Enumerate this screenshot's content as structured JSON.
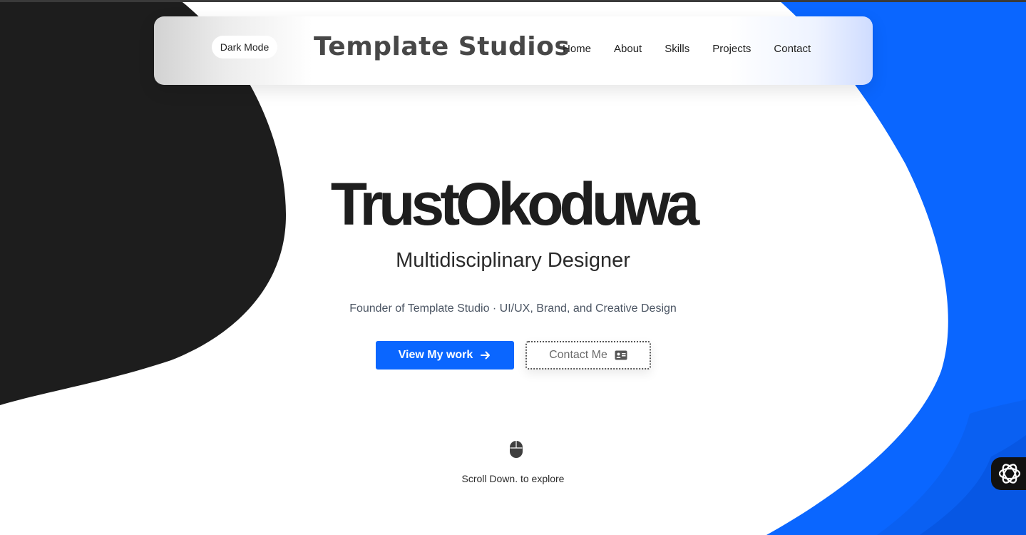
{
  "colors": {
    "accent": "#0a66ff",
    "dark_shape": "#1d1d1d",
    "blue_shape": "#0a66ff",
    "text": "#1e1e1e"
  },
  "header": {
    "dark_mode_label": "Dark Mode",
    "brand": "Template Studios",
    "nav": [
      "Home",
      "About",
      "Skills",
      "Projects",
      "Contact"
    ]
  },
  "hero": {
    "name": "TrustOkoduwa",
    "title": "Multidisciplinary Designer",
    "subtitle": "Founder of Template Studio · UI/UX, Brand, and Creative Design",
    "primary_button": {
      "label": "View My work",
      "icon": "arrow-right-icon"
    },
    "secondary_button": {
      "label": "Contact Me",
      "icon": "id-card-icon"
    }
  },
  "scroll": {
    "icon": "mouse-icon",
    "text": "Scroll Down. to explore"
  },
  "widget": {
    "icon": "openai-logo-icon"
  }
}
